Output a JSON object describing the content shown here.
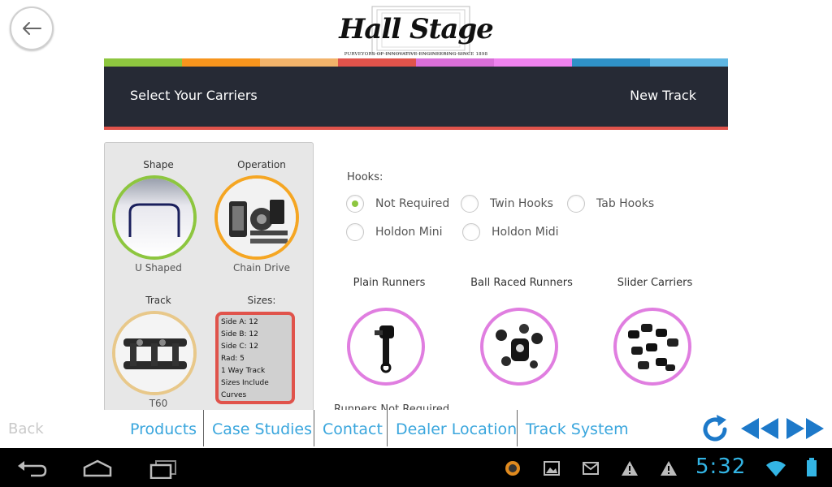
{
  "logo": {
    "name": "Hall Stage",
    "tagline": "PURVEYORS OF INNOVATIVE ENGINEERING SINCE 1898"
  },
  "color_strip": [
    "#8dc63f",
    "#f7941d",
    "#f2b36a",
    "#e0534b",
    "#d96fd8",
    "#ee82ee",
    "#2f91c7",
    "#5fb6e2"
  ],
  "header": {
    "left": "Select Your Carriers",
    "right": "New Track"
  },
  "summary": {
    "shape": {
      "title": "Shape",
      "caption": "U Shaped",
      "ring_color": "#8dc63f"
    },
    "operation": {
      "title": "Operation",
      "caption": "Chain Drive",
      "ring_color": "#f5a623"
    },
    "track": {
      "title": "Track",
      "caption": "T60",
      "ring_color": "#e8c88a"
    },
    "sizes": {
      "title": "Sizes:",
      "lines": [
        "Side A: 12",
        "Side B: 12",
        "Side C: 12",
        "Rad: 5",
        "1 Way Track",
        "Sizes Include Curves"
      ]
    }
  },
  "hooks": {
    "label": "Hooks:",
    "options": [
      {
        "label": "Not Required",
        "selected": true
      },
      {
        "label": "Twin Hooks",
        "selected": false
      },
      {
        "label": "Tab Hooks",
        "selected": false
      },
      {
        "label": "Holdon Mini",
        "selected": false
      },
      {
        "label": "Holdon Midi",
        "selected": false
      }
    ]
  },
  "runners": [
    {
      "title": "Plain Runners"
    },
    {
      "title": "Ball Raced Runners"
    },
    {
      "title": "Slider Carriers"
    }
  ],
  "runners_note": "Runners Not Required",
  "nav": {
    "back": "Back",
    "links": [
      "Products",
      "Case Studies",
      "Contact",
      "Dealer Location",
      "Track System"
    ]
  },
  "status": {
    "time": "5:32"
  }
}
